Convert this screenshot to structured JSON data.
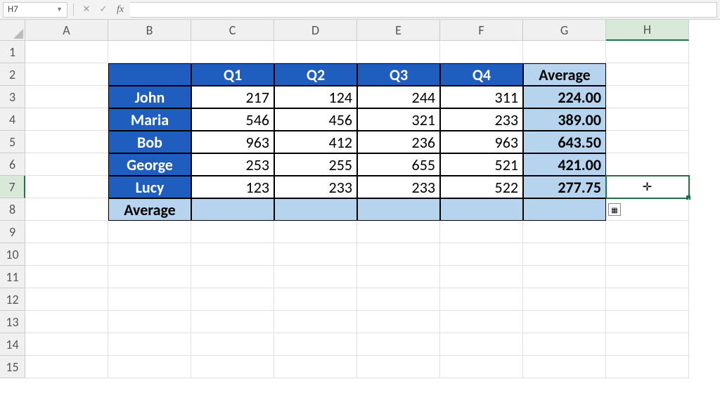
{
  "namebox": "H7",
  "formula": "",
  "col_headers": [
    "A",
    "B",
    "C",
    "D",
    "E",
    "F",
    "G",
    "H"
  ],
  "row_headers": [
    "1",
    "2",
    "3",
    "4",
    "5",
    "6",
    "7",
    "8",
    "9",
    "10",
    "11",
    "12",
    "13",
    "14",
    "15"
  ],
  "active_col": "H",
  "active_row": "7",
  "table": {
    "quarter_headers": [
      "Q1",
      "Q2",
      "Q3",
      "Q4"
    ],
    "avg_header": "Average",
    "rows": [
      {
        "name": "John",
        "q": [
          217,
          124,
          244,
          311
        ],
        "avg": "224.00"
      },
      {
        "name": "Maria",
        "q": [
          546,
          456,
          321,
          233
        ],
        "avg": "389.00"
      },
      {
        "name": "Bob",
        "q": [
          963,
          412,
          236,
          963
        ],
        "avg": "643.50"
      },
      {
        "name": "George",
        "q": [
          253,
          255,
          655,
          521
        ],
        "avg": "421.00"
      },
      {
        "name": "Lucy",
        "q": [
          123,
          233,
          233,
          522
        ],
        "avg": "277.75"
      }
    ],
    "footer_label": "Average"
  },
  "chart_data": {
    "type": "table",
    "categories": [
      "Q1",
      "Q2",
      "Q3",
      "Q4",
      "Average"
    ],
    "series": [
      {
        "name": "John",
        "values": [
          217,
          124,
          244,
          311,
          224.0
        ]
      },
      {
        "name": "Maria",
        "values": [
          546,
          456,
          321,
          233,
          389.0
        ]
      },
      {
        "name": "Bob",
        "values": [
          963,
          412,
          236,
          963,
          643.5
        ]
      },
      {
        "name": "George",
        "values": [
          253,
          255,
          655,
          521,
          421.0
        ]
      },
      {
        "name": "Lucy",
        "values": [
          123,
          233,
          233,
          522,
          277.75
        ]
      }
    ],
    "title": "",
    "xlabel": "",
    "ylabel": ""
  }
}
